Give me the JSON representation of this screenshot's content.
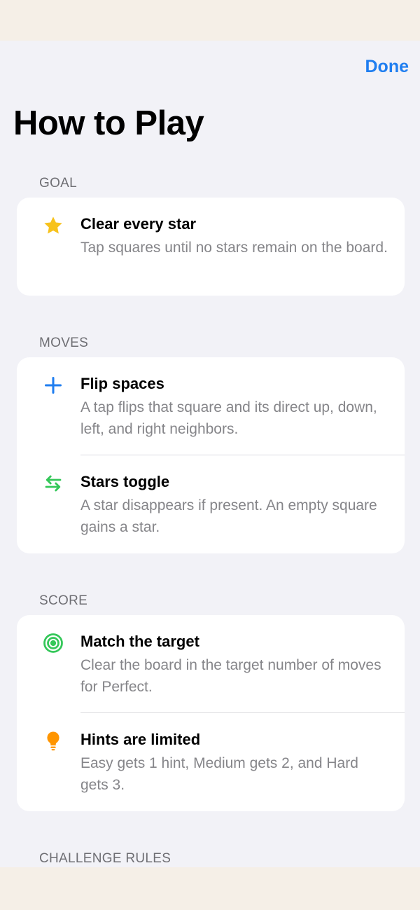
{
  "header": {
    "done_label": "Done",
    "title": "How to Play"
  },
  "sections": [
    {
      "header": "GOAL",
      "rows": [
        {
          "icon": "star-icon",
          "icon_color": "#f7c21c",
          "title": "Clear every star",
          "description": "Tap squares until no stars remain on the board."
        }
      ]
    },
    {
      "header": "MOVES",
      "rows": [
        {
          "icon": "plus-icon",
          "icon_color": "#1f7ef0",
          "title": "Flip spaces",
          "description": "A tap flips that square and its direct up, down, left, and right neighbors."
        },
        {
          "icon": "swap-arrows-icon",
          "icon_color": "#34c759",
          "title": "Stars toggle",
          "description": "A star disappears if present. An empty square gains a star."
        }
      ]
    },
    {
      "header": "SCORE",
      "rows": [
        {
          "icon": "target-icon",
          "icon_color": "#34c759",
          "title": "Match the target",
          "description": "Clear the board in the target number of moves for Perfect."
        },
        {
          "icon": "lightbulb-icon",
          "icon_color": "#ff9500",
          "title": "Hints are limited",
          "description": "Easy gets 1 hint, Medium gets 2, and Hard gets 3."
        }
      ]
    },
    {
      "header": "CHALLENGE RULES",
      "rows": []
    }
  ],
  "colors": {
    "accent": "#1f7ef0",
    "background": "#f2f2f7",
    "card": "#ffffff",
    "secondary_text": "#858589"
  }
}
